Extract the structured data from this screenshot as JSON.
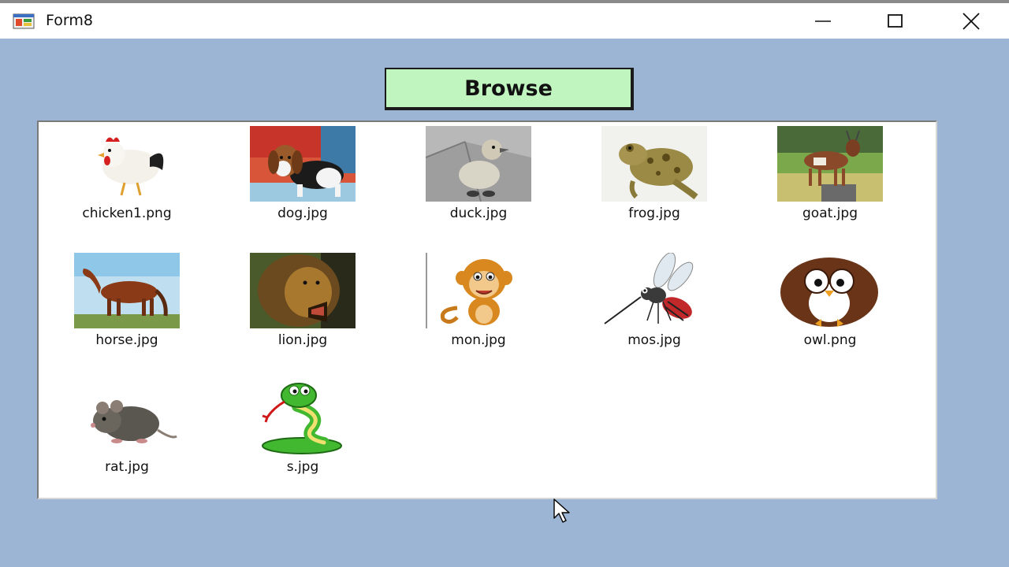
{
  "window": {
    "title": "Form8",
    "minimize_glyph": "—",
    "maximize_glyph": "☐",
    "close_glyph": "✕"
  },
  "colors": {
    "client_bg": "#9db5d4",
    "button_bg": "#c1f5c0",
    "list_bg": "#ffffff"
  },
  "browse_button": {
    "label": "Browse"
  },
  "images": [
    {
      "caption": "chicken1.png",
      "icon": "chicken-icon"
    },
    {
      "caption": "dog.jpg",
      "icon": "dog-icon"
    },
    {
      "caption": "duck.jpg",
      "icon": "duck-icon"
    },
    {
      "caption": "frog.jpg",
      "icon": "frog-icon"
    },
    {
      "caption": "goat.jpg",
      "icon": "goat-icon"
    },
    {
      "caption": "horse.jpg",
      "icon": "horse-icon"
    },
    {
      "caption": "lion.jpg",
      "icon": "lion-icon"
    },
    {
      "caption": "mon.jpg",
      "icon": "monkey-icon"
    },
    {
      "caption": "mos.jpg",
      "icon": "mosquito-icon"
    },
    {
      "caption": "owl.png",
      "icon": "owl-icon"
    },
    {
      "caption": "rat.jpg",
      "icon": "rat-icon"
    },
    {
      "caption": "s.jpg",
      "icon": "snake-icon"
    }
  ]
}
